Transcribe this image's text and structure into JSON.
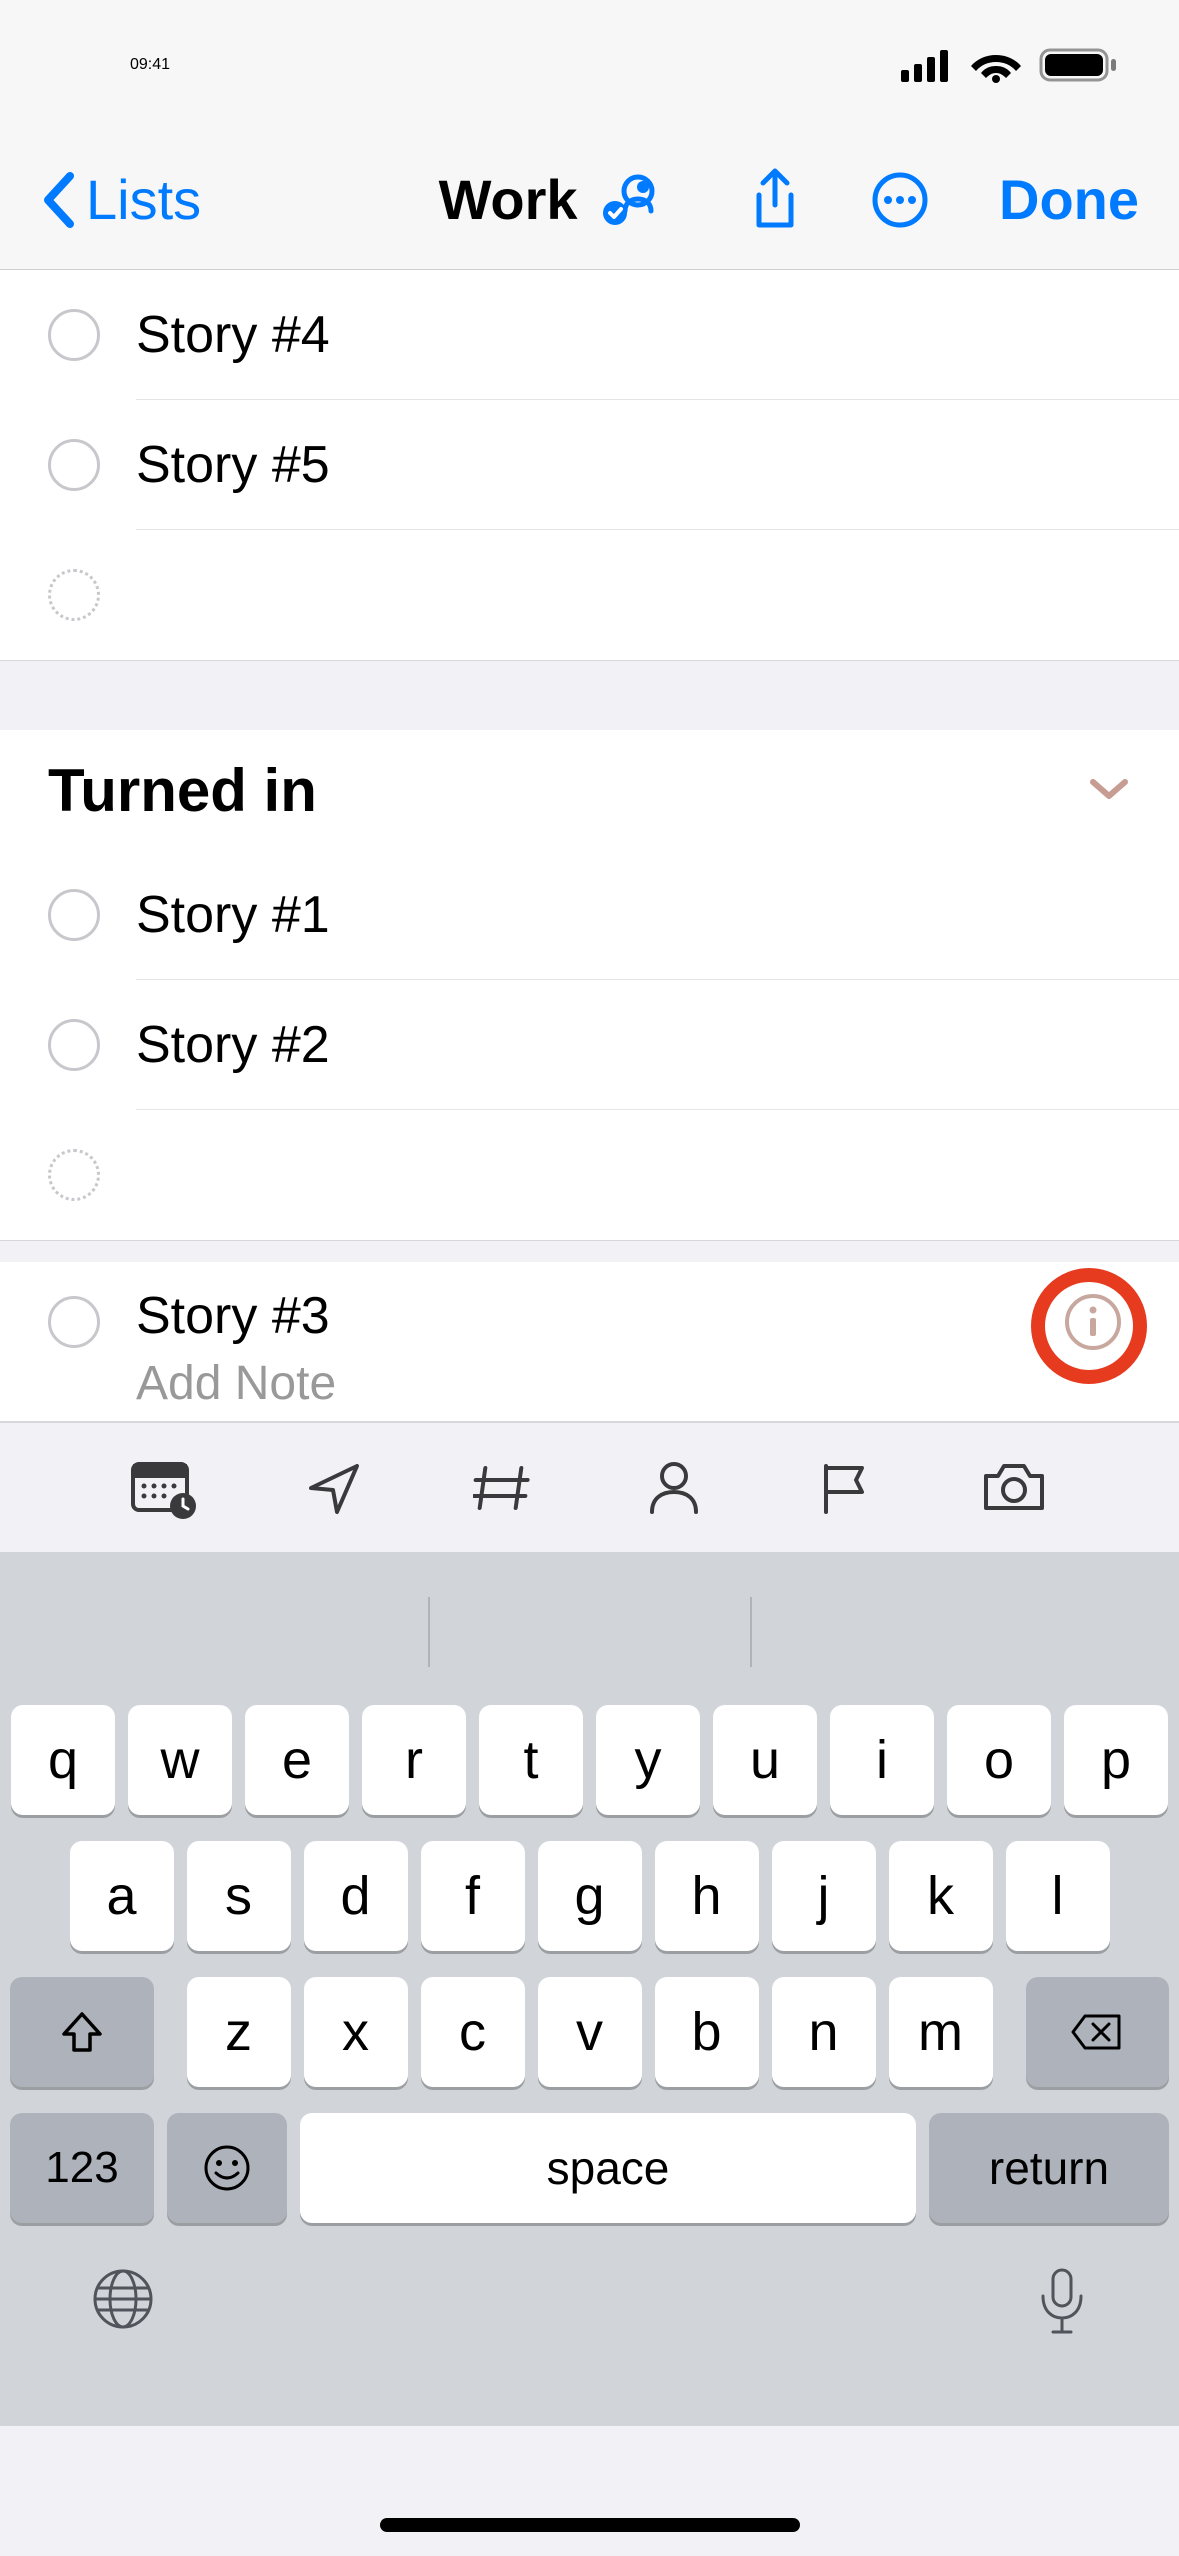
{
  "status": {
    "time": "09:41"
  },
  "nav": {
    "back_label": "Lists",
    "title": "Work",
    "done_label": "Done"
  },
  "items_top": [
    {
      "title": "Story #4"
    },
    {
      "title": "Story #5"
    }
  ],
  "section": {
    "title": "Turned in"
  },
  "items_section": [
    {
      "title": "Story #1"
    },
    {
      "title": "Story #2"
    }
  ],
  "selected": {
    "title": "Story #3",
    "note_placeholder": "Add Note"
  },
  "keyboard": {
    "row1": [
      "q",
      "w",
      "e",
      "r",
      "t",
      "y",
      "u",
      "i",
      "o",
      "p"
    ],
    "row2": [
      "a",
      "s",
      "d",
      "f",
      "g",
      "h",
      "j",
      "k",
      "l"
    ],
    "row3": [
      "z",
      "x",
      "c",
      "v",
      "b",
      "n",
      "m"
    ],
    "num": "123",
    "space": "space",
    "return": "return"
  }
}
